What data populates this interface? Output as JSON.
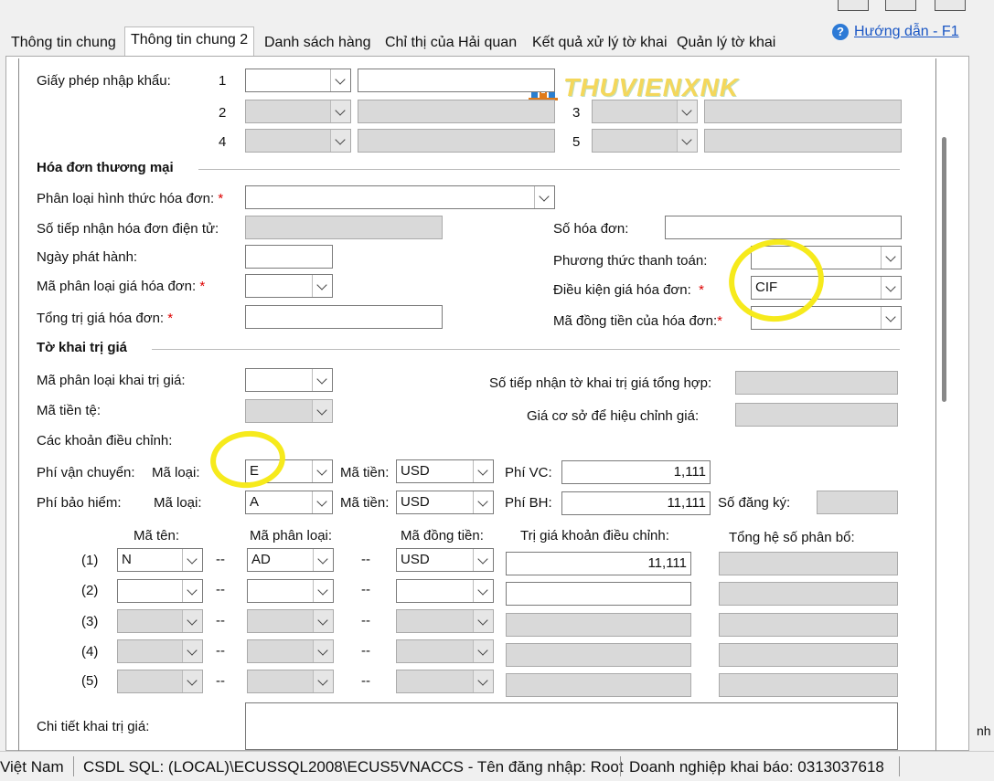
{
  "tabs": [
    {
      "label": "Thông tin chung"
    },
    {
      "label": "Thông tin chung 2"
    },
    {
      "label": "Danh sách hàng"
    },
    {
      "label": "Chỉ thị của Hải quan"
    },
    {
      "label": "Kết quả xử lý tờ khai"
    },
    {
      "label": "Quản lý tờ khai"
    }
  ],
  "help_link": "Hướng dẫn - F1",
  "watermark": "THUVIENXNK",
  "license": {
    "label": "Giấy phép nhập khẩu:",
    "rows": [
      "1",
      "2",
      "3",
      "4",
      "5"
    ]
  },
  "invoice": {
    "section_title": "Hóa đơn thương mại",
    "type_label": "Phân loại hình thức hóa đơn:",
    "einvoice_label": "Số tiếp nhận hóa đơn điện tử:",
    "invoice_no_label": "Số hóa đơn:",
    "issue_date_label": "Ngày phát hành:",
    "payment_label": "Phương thức thanh toán:",
    "price_type_label": "Mã phân loại giá hóa đơn:",
    "terms_label": "Điều kiện giá hóa đơn:",
    "terms_value": "CIF",
    "total_label": "Tổng trị giá hóa đơn:",
    "currency_label": "Mã đồng tiền của hóa đơn:"
  },
  "valuation": {
    "section_title": "Tờ khai trị giá",
    "type_label": "Mã phân loại khai trị giá:",
    "summary_no_label": "Số tiếp nhận tờ khai trị giá tổng hợp:",
    "currency_label": "Mã tiền tệ:",
    "base_price_label": "Giá cơ sở để hiệu chỉnh giá:",
    "adjustments_label": "Các khoản điều chỉnh:",
    "freight_label": "Phí vận chuyển:",
    "insurance_label": "Phí bảo hiểm:",
    "code_type_label": "Mã loại:",
    "currency_code_label": "Mã tiền:",
    "freight_type": "E",
    "freight_currency": "USD",
    "freight_fee_label": "Phí VC:",
    "freight_fee": "1,111",
    "insurance_type": "A",
    "insurance_currency": "USD",
    "insurance_fee_label": "Phí BH:",
    "insurance_fee": "11,111",
    "reg_no_label": "Số đăng ký:"
  },
  "adjust_table": {
    "headers": [
      "Mã tên:",
      "Mã phân loại:",
      "Mã đồng tiền:",
      "Trị giá khoản điều chỉnh:",
      "Tổng hệ số phân bổ:"
    ],
    "dash": "--",
    "rows": [
      {
        "idx": "(1)",
        "name": "N",
        "type": "AD",
        "currency": "USD",
        "value": "11,111"
      },
      {
        "idx": "(2)",
        "name": "",
        "type": "",
        "currency": "",
        "value": ""
      },
      {
        "idx": "(3)",
        "name": "",
        "type": "",
        "currency": "",
        "value": ""
      },
      {
        "idx": "(4)",
        "name": "",
        "type": "",
        "currency": "",
        "value": ""
      },
      {
        "idx": "(5)",
        "name": "",
        "type": "",
        "currency": "",
        "value": ""
      }
    ]
  },
  "detail_label": "Chi tiết khai trị giá:",
  "side_text": "nh",
  "status": {
    "country": "Việt Nam",
    "db": "CSDL SQL: (LOCAL)\\ECUSSQL2008\\ECUS5VNACCS - Tên đăng nhập: Root",
    "company": "Doanh nghiệp khai báo: 0313037618"
  },
  "colors": {
    "highlight": "#f6ea1c",
    "link": "#1a56c4",
    "disabled": "#d9d9d9"
  }
}
